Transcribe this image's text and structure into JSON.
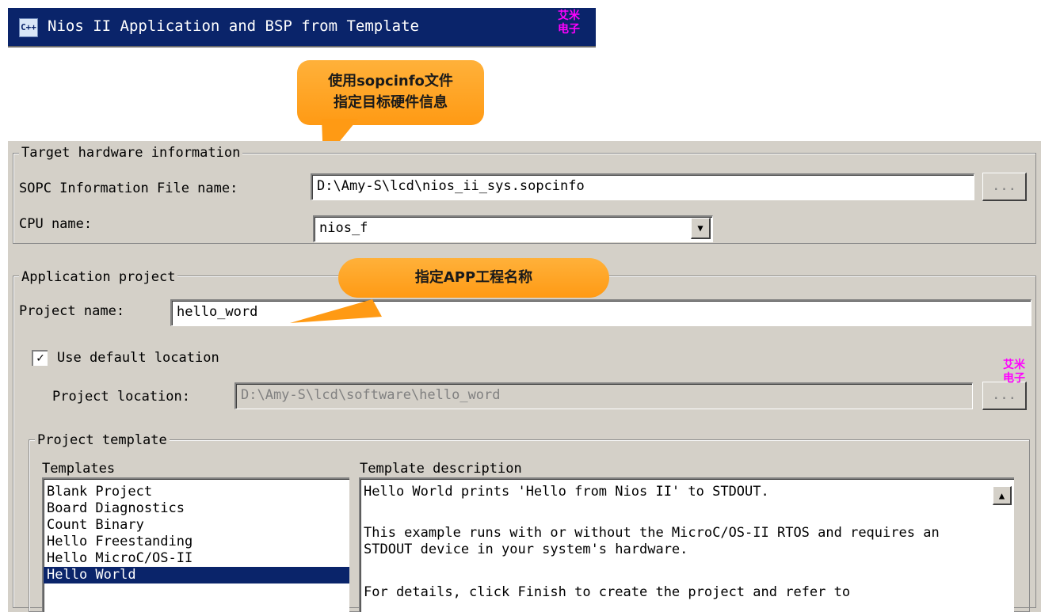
{
  "window": {
    "title": "Nios II Application and BSP from Template",
    "title_icon": "C++",
    "watermark_line1": "艾米",
    "watermark_line2": "电子"
  },
  "callouts": {
    "sopcinfo_line1": "使用sopcinfo文件",
    "sopcinfo_line2": "指定目标硬件信息",
    "app_name": "指定APP工程名称"
  },
  "target_hardware": {
    "legend": "Target hardware information",
    "sopc_label": "SOPC Information File name:",
    "sopc_value": "D:\\Amy-S\\lcd\\nios_ii_sys.sopcinfo",
    "browse_label": "...",
    "cpu_label": "CPU name:",
    "cpu_value": "nios_f"
  },
  "application_project": {
    "legend": "Application project",
    "project_name_label": "Project name:",
    "project_name_value": "hello_word",
    "use_default_label": "Use default location",
    "use_default_checked": true,
    "location_label": "Project location:",
    "location_value": "D:\\Amy-S\\lcd\\software\\hello_word",
    "browse_label": "..."
  },
  "project_template": {
    "legend": "Project template",
    "templates_label": "Templates",
    "templates": [
      "Blank Project",
      "Board Diagnostics",
      "Count Binary",
      "Hello Freestanding",
      "Hello MicroC/OS-II",
      "Hello World"
    ],
    "selected_template": "Hello World",
    "description_label": "Template description",
    "description_p1": "Hello World prints 'Hello from Nios II' to STDOUT.",
    "description_p2": "This example runs with or without the MicroC/OS-II RTOS and requires an STDOUT device in your system's hardware.",
    "description_p3": "For details, click Finish to create the project and refer to"
  },
  "colors": {
    "titlebar": "#0a246a",
    "dialog_bg": "#d4d0c8",
    "callout": "#ff9a14",
    "selection": "#0a246a",
    "watermark": "#ff00ff"
  }
}
